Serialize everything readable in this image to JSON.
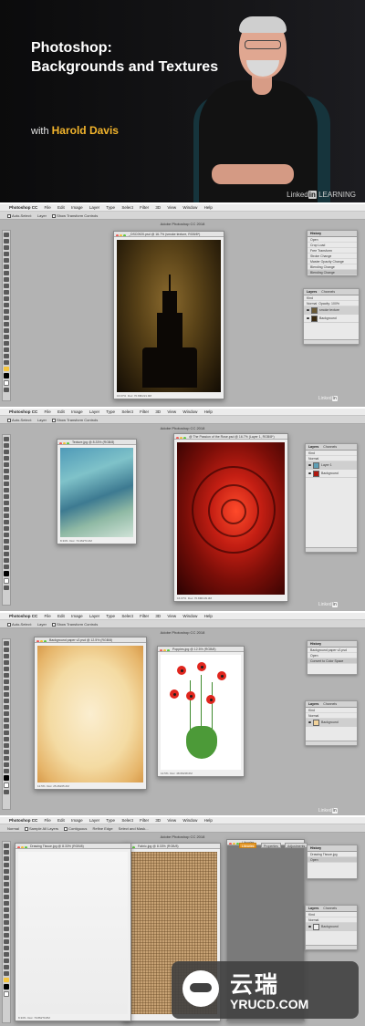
{
  "hero": {
    "title_line1": "Photoshop:",
    "title_line2": "Backgrounds and Textures",
    "with": "with",
    "author": "Harold Davis",
    "brand": "Linked",
    "brand_badge": "in",
    "brand_suffix": "LEARNING",
    "colors": {
      "author": "#f2b42c",
      "background": "#0b0b0c"
    }
  },
  "menubar": {
    "apple": "",
    "items": [
      "Photoshop CC",
      "File",
      "Edit",
      "Image",
      "Layer",
      "Type",
      "Select",
      "Filter",
      "3D",
      "View",
      "Window",
      "Help"
    ]
  },
  "app_title": "Adobe Photoshop CC 2018",
  "options_bar": {
    "auto_select": "Auto-Select:",
    "layer": "Layer",
    "show_transform": "Show Transform Controls"
  },
  "shot1": {
    "doc_title": "_DSC0920.psd @ 16.7% (smoke texture, RGB/8*)",
    "doc_zoom": "16.67%",
    "doc_info": "Doc: 70.8M/221.9M",
    "history_panel": {
      "tab": "History",
      "items": [
        "Open",
        "Crop Load",
        "Free Transform",
        "Stroke Change",
        "Master Opacity Change",
        "Blending Change",
        "Blending Change"
      ]
    },
    "layers_panel": {
      "tabs": [
        "Layers",
        "Channels"
      ],
      "kind": "Kind",
      "mode": "Normal",
      "opacity": "Opacity: 100%",
      "layers": [
        "smoke texture",
        "Background"
      ]
    },
    "brand": "Linked"
  },
  "shot2": {
    "doc1_title": "Texture.jpg @ 8.33% (RGB/8)",
    "doc1_zoom": "8.33%",
    "doc1_info": "Doc: 73.4M/73.4M",
    "doc2_title": "@ The Passion of the Rose.psd @ 16.7% (Layer 1, RGB/8*)",
    "doc2_zoom": "16.67%",
    "doc2_info": "Doc: 70.8M/139.3M",
    "layers_panel": {
      "tabs": [
        "Layers",
        "Channels"
      ],
      "layers": [
        "Layer 1",
        "Background"
      ]
    },
    "brand": "Linked"
  },
  "shot3": {
    "doc1_title": "Background paper v2.psd @ 12.5% (RGB/8)",
    "doc1_zoom": "12.5%",
    "doc1_info": "Doc: 25.2M/25.2M",
    "doc2_title": "Poppies.jpg @ 12.5% (RGB/8)",
    "doc2_zoom": "12.5%",
    "doc2_info": "Doc: 48.6M/48.6M",
    "history_panel": {
      "tab": "History",
      "items": [
        "Background paper v2.psd",
        "Open",
        "Convert to Color Space"
      ]
    },
    "layers_panel": {
      "tabs": [
        "Layers",
        "Channels"
      ],
      "layers": [
        "Background"
      ]
    },
    "brand": "Linked"
  },
  "shot4": {
    "doc1_title": "Drawing Tissue.jpg @ 8.33% (RGB/8)",
    "doc1_zoom": "8.33%",
    "doc1_info": "Doc: 70.8M/70.8M",
    "doc2_title": "Fabric.jpg @ 8.33% (RGB/8)",
    "doc3_title": "Libraries",
    "library_tabs": [
      "Libraries",
      "Properties",
      "Adjustments"
    ],
    "options": [
      "Normal",
      "Sample All Layers",
      "Contiguous",
      "Refine Edge",
      "Select and Mask..."
    ],
    "history_panel": {
      "tab": "History",
      "items": [
        "Drawing Tissue.jpg",
        "Open"
      ]
    },
    "layers_panel": {
      "tabs": [
        "Layers",
        "Channels"
      ],
      "layers": [
        "Background"
      ]
    },
    "brand": "Linked"
  },
  "watermark": {
    "chinese": "云瑞",
    "domain": "YRUCD.COM"
  }
}
